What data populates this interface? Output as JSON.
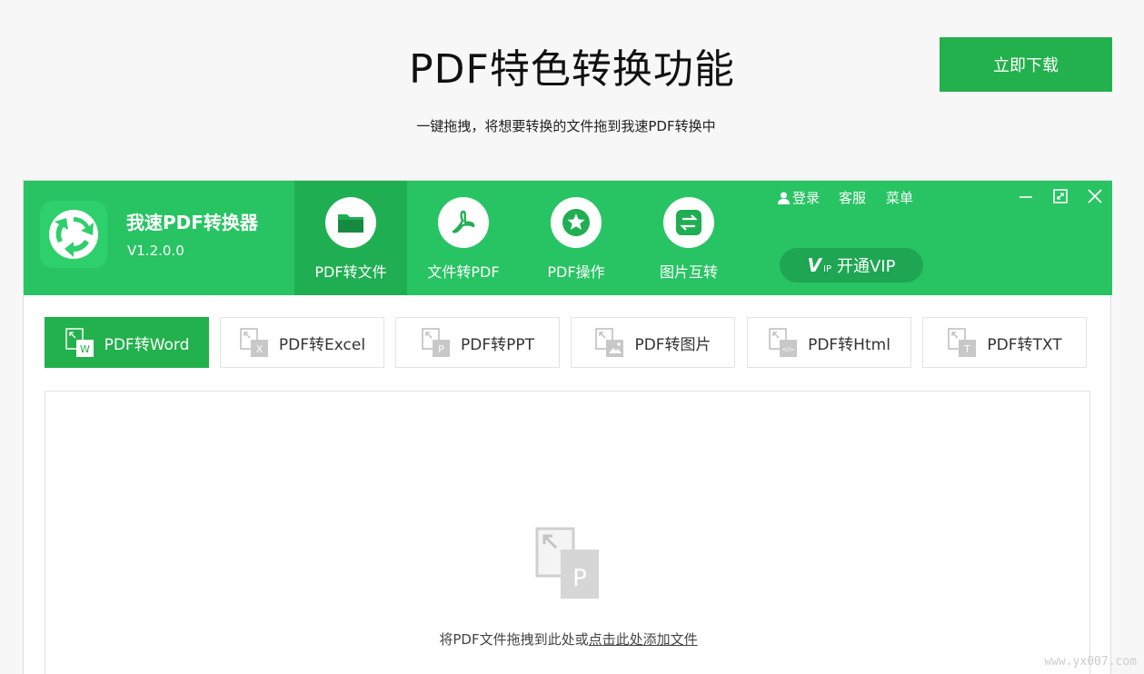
{
  "page": {
    "title": "PDF特色转换功能",
    "subtitle": "一键拖拽，将想要转换的文件拖到我速PDF转换中",
    "download_label": "立即下载"
  },
  "app": {
    "name": "我速PDF转换器",
    "version": "V1.2.0.0",
    "nav_tabs": [
      {
        "label": "PDF转文件",
        "icon": "folder-icon",
        "active": true
      },
      {
        "label": "文件转PDF",
        "icon": "pdf-icon",
        "active": false
      },
      {
        "label": "PDF操作",
        "icon": "star-icon",
        "active": false
      },
      {
        "label": "图片互转",
        "icon": "swap-icon",
        "active": false
      }
    ],
    "top_links": {
      "login": "登录",
      "service": "客服",
      "menu": "菜单"
    },
    "vip_label": "开通VIP",
    "vip_badge": "IP",
    "sub_tabs": [
      {
        "label": "PDF转Word",
        "badge": "W",
        "active": true
      },
      {
        "label": "PDF转Excel",
        "badge": "X",
        "active": false
      },
      {
        "label": "PDF转PPT",
        "badge": "P",
        "active": false
      },
      {
        "label": "PDF转图片",
        "badge": "",
        "active": false
      },
      {
        "label": "PDF转Html",
        "badge": "</>",
        "active": false
      },
      {
        "label": "PDF转TXT",
        "badge": "T",
        "active": false
      }
    ],
    "drop_zone": {
      "badge": "P",
      "text_plain": "将PDF文件拖拽到此处或",
      "text_link": "点击此处添加文件"
    }
  },
  "watermark": "www.yx007.com",
  "colors": {
    "brand": "#28c463",
    "active": "#22b14c"
  }
}
